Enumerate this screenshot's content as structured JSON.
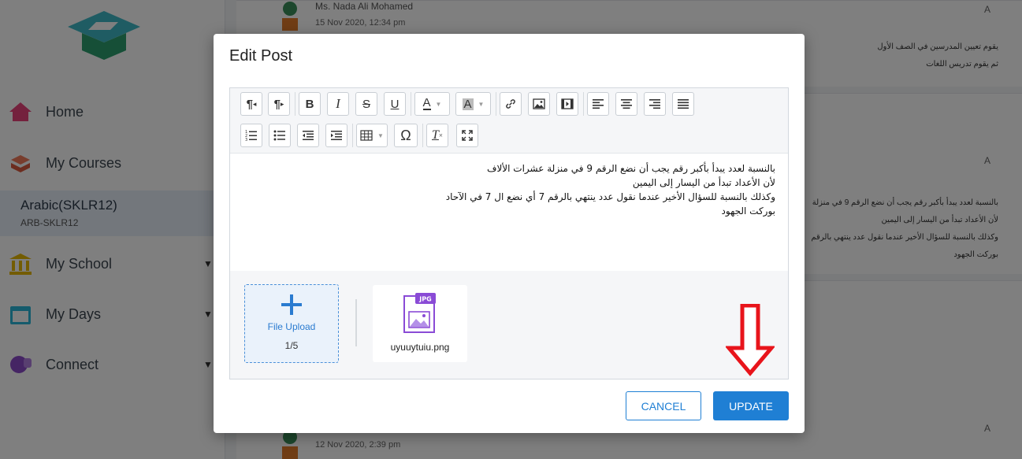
{
  "sidebar": {
    "items": [
      {
        "label": "Home",
        "icon": "home-icon"
      },
      {
        "label": "My Courses",
        "icon": "courses-icon"
      },
      {
        "label": "My School",
        "icon": "school-icon"
      },
      {
        "label": "My Days",
        "icon": "calendar-icon"
      },
      {
        "label": "Connect",
        "icon": "chat-icon"
      }
    ],
    "course": {
      "name": "Arabic(SKLR12)",
      "code": "ARB-SKLR12"
    }
  },
  "feed": {
    "posts": [
      {
        "author": "Ms. Nada Ali Mohamed",
        "date": "15 Nov 2020, 12:34 pm",
        "badge": "A",
        "lines": [
          "يقوم تعيين المدرسين في الصف الأول",
          "ثم يقوم تدريس اللغات"
        ]
      },
      {
        "badge": "A",
        "lines": [
          "بالنسبة لعدد يبدأ بأكبر رقم يجب أن نضع الرقم 9 في منزلة",
          "لأن الأعداد تبدأ من اليسار إلى اليمين",
          "وكذلك بالنسبة للسؤال الأخير عندما نقول عدد ينتهي بالرقم",
          "بوركت الجهود"
        ]
      },
      {
        "date": "12 Nov 2020, 2:39 pm",
        "badge": "A"
      }
    ]
  },
  "modal": {
    "title": "Edit Post",
    "toolbar": {
      "row1": [
        {
          "name": "ltr-paragraph-button",
          "glyph": "¶"
        },
        {
          "name": "rtl-paragraph-button",
          "glyph": "¶"
        },
        {
          "name": "bold-button",
          "glyph": "B"
        },
        {
          "name": "italic-button",
          "glyph": "I"
        },
        {
          "name": "strikethrough-button",
          "glyph": "S"
        },
        {
          "name": "underline-button",
          "glyph": "U"
        },
        {
          "name": "font-color-button",
          "glyph": "A"
        },
        {
          "name": "highlight-color-button",
          "glyph": "A"
        }
      ],
      "row2_glyphs": {
        "special_char": "Ω",
        "clear_format": "T"
      }
    },
    "content_lines": [
      "بالنسبة لعدد يبدأ بأكبر رقم يجب أن نضع الرقم 9 في منزلة عشرات الألاف",
      "لأن الأعداد تبدأ من اليسار إلى اليمين",
      "وكذلك بالنسبة للسؤال الأخير عندما نقول عدد ينتهي بالرقم 7 أي نضع ال 7 في الآحاد",
      "بوركت الجهود"
    ],
    "upload": {
      "label": "File Upload",
      "count": "1/5"
    },
    "file": {
      "name": "uyuuytuiu.png",
      "type_badge": "JPG"
    },
    "buttons": {
      "cancel": "CANCEL",
      "update": "UPDATE"
    }
  },
  "colors": {
    "accent": "#1f7fd4",
    "annotation_arrow": "#e8141b",
    "upload_border": "#4a90d9"
  }
}
